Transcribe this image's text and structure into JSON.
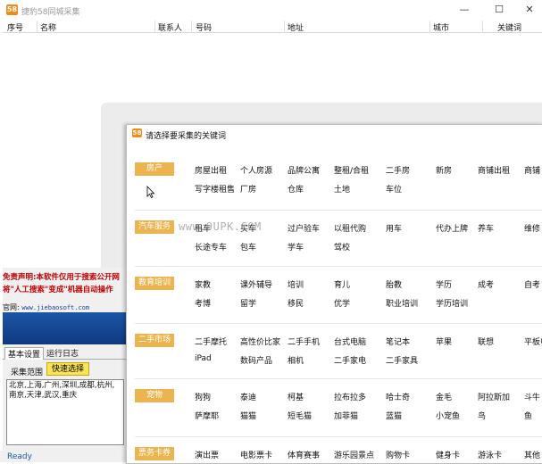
{
  "window": {
    "icon_text": "58",
    "title": "捷豹58同城采集",
    "minimize": "—",
    "maximize": "☐",
    "close": "✕"
  },
  "table": {
    "columns": [
      "序号",
      "名称",
      "联系人",
      "号码",
      "地址",
      "城市",
      "关键词"
    ]
  },
  "left": {
    "disclaimer_line1": "免责声明:本软件仅用于搜索公开网",
    "disclaimer_line2": "将\"人工搜索\"变成\"机器自动操作",
    "website_label": "官网:",
    "website_url": "www.jiebaosoft.com",
    "tabs": [
      "基本设置",
      "运行日志"
    ],
    "scope_label": "采集范围",
    "quick_select": "快速选择",
    "cities": "北京,上海,广州,深圳,成都,杭州,南京,天津,武汉,重庆"
  },
  "status": "Ready",
  "dialog": {
    "icon_text": "58",
    "title": "请选择要采集的关键词",
    "categories": [
      {
        "name": "房产",
        "rows": [
          [
            "房屋出租",
            "个人房源",
            "品牌公寓",
            "整租/合租",
            "二手房",
            "新房",
            "商铺出租",
            "商铺"
          ],
          [
            "写字楼租售",
            "厂房",
            "仓库",
            "土地",
            "车位"
          ]
        ]
      },
      {
        "name": "汽车服务",
        "rows": [
          [
            "租车",
            "买车",
            "过户验车",
            "以租代购",
            "用车",
            "代办上牌",
            "养车",
            "维修"
          ],
          [
            "长途专车",
            "包车",
            "学车",
            "驾校"
          ]
        ]
      },
      {
        "name": "教育培训",
        "rows": [
          [
            "家教",
            "课外辅导",
            "培训",
            "育儿",
            "胎教",
            "学历",
            "成考",
            "自考"
          ],
          [
            "考博",
            "留学",
            "移民",
            "优学",
            "职业培训",
            "学历培训"
          ]
        ]
      },
      {
        "name": "二手市场",
        "rows": [
          [
            "二手摩托",
            "高性价比家",
            "二手手机",
            "台式电脑",
            "笔记本",
            "苹果",
            "联想",
            "平板电"
          ],
          [
            "iPad",
            "数码产品",
            "相机",
            "二手家电",
            "二手家具"
          ]
        ]
      },
      {
        "name": "宠物",
        "rows": [
          [
            "狗狗",
            "泰迪",
            "柯基",
            "拉布拉多",
            "哈士奇",
            "金毛",
            "阿拉斯加",
            "斗牛"
          ],
          [
            "萨摩耶",
            "猫猫",
            "短毛猫",
            "加菲猫",
            "蓝猫",
            "小宠鱼",
            "鸟",
            "鱼"
          ]
        ]
      },
      {
        "name": "票务卡券",
        "rows": [
          [
            "演出票",
            "电影票卡",
            "体育赛事",
            "游乐园景点",
            "购物卡",
            "健身卡",
            "游泳卡",
            "其他"
          ]
        ]
      }
    ]
  },
  "watermark": "www.9UPK.COM",
  "colors": {
    "category_bg": "#ebb44e",
    "disclaimer": "#c00000",
    "banner": "#1d55a6",
    "status": "#1a5aa8",
    "quick_btn": "#f8e45a"
  }
}
